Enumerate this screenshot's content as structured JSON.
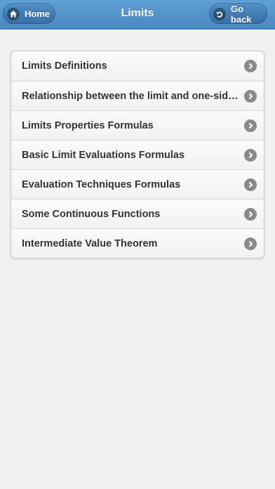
{
  "header": {
    "title": "Limits",
    "home_label": "Home",
    "back_label": "Go back",
    "home_icon": "home-icon",
    "back_icon": "back-arrow-icon"
  },
  "list": {
    "items": [
      {
        "label": "Limits Definitions"
      },
      {
        "label": "Relationship between the limit and one-sided limits"
      },
      {
        "label": "Limits Properties Formulas"
      },
      {
        "label": "Basic Limit Evaluations Formulas"
      },
      {
        "label": "Evaluation Techniques Formulas"
      },
      {
        "label": "Some Continuous Functions"
      },
      {
        "label": "Intermediate Value Theorem"
      }
    ],
    "chevron_icon": "chevron-right-icon"
  },
  "colors": {
    "header_top": "#5e9fd4",
    "header_bottom": "#4a89c2",
    "background": "#f0f0f0",
    "text": "#333333",
    "chevron": "#8a8a8a"
  }
}
